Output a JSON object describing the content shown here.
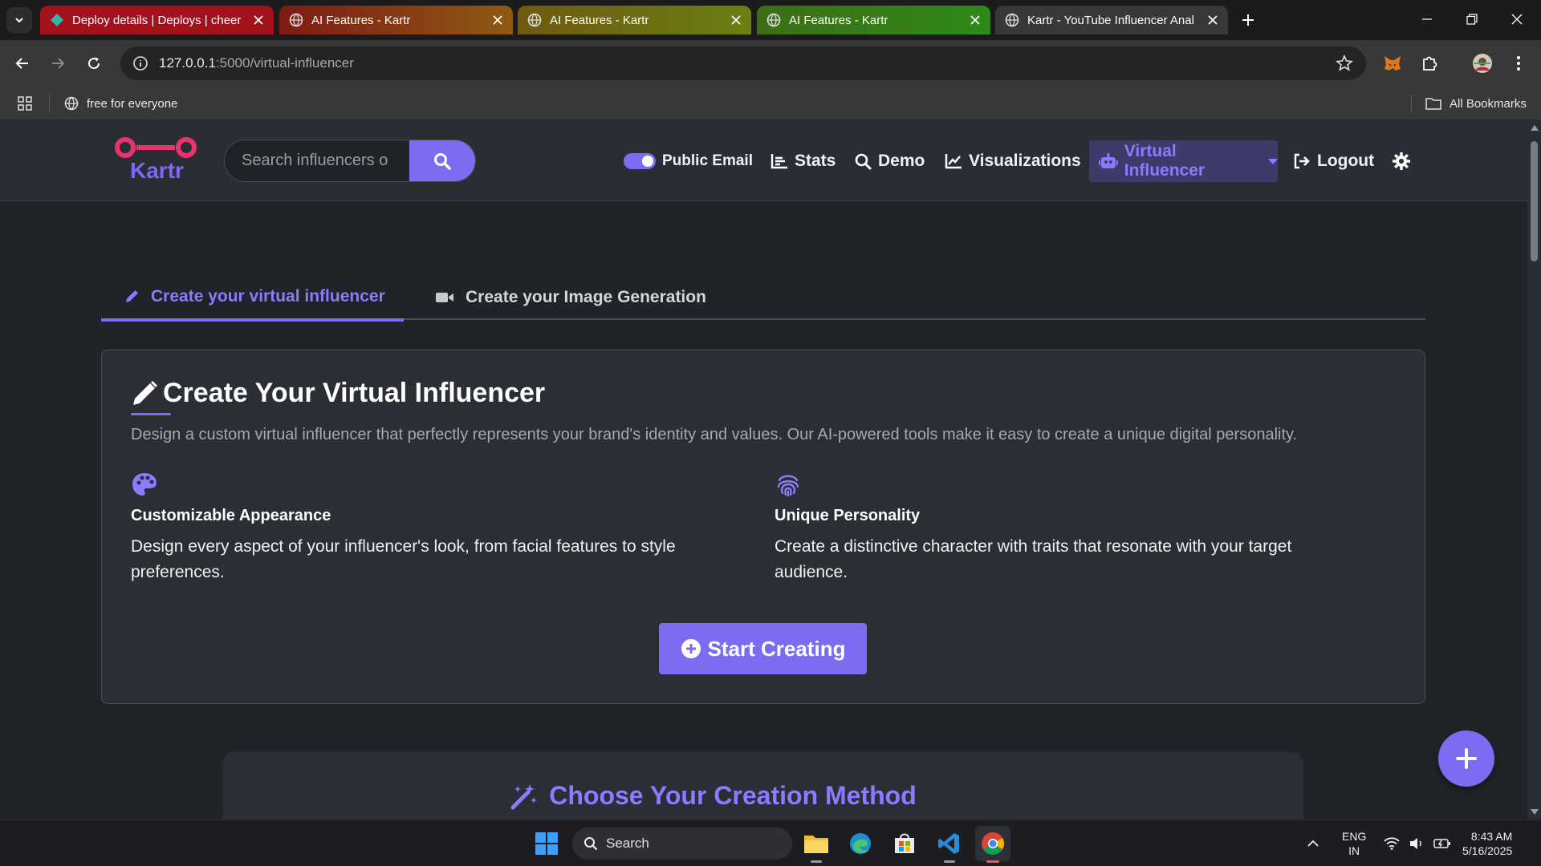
{
  "browser": {
    "tabs": [
      {
        "title": "Deploy details | Deploys | cheer"
      },
      {
        "title": "AI Features - Kartr"
      },
      {
        "title": "AI Features - Kartr"
      },
      {
        "title": "AI Features - Kartr"
      },
      {
        "title": "Kartr - YouTube Influencer Anal"
      }
    ],
    "url_host": "127.0.0.1",
    "url_rest": ":5000/virtual-influencer",
    "bookmark": "free for everyone",
    "all_bookmarks": "All Bookmarks"
  },
  "navbar": {
    "logo_text": "Kartr",
    "search_placeholder": "Search influencers o",
    "public_email": "Public Email",
    "stats": "Stats",
    "demo": "Demo",
    "visualizations": "Visualizations",
    "virtual_influencer": "Virtual Influencer",
    "logout": "Logout"
  },
  "tabs": {
    "create_influencer": "Create your virtual influencer",
    "image_generation": "Create your Image Generation"
  },
  "card": {
    "title": "Create Your Virtual Influencer",
    "description": "Design a custom virtual influencer that perfectly represents your brand's identity and values. Our AI-powered tools make it easy to create a unique digital personality.",
    "features": [
      {
        "title": "Customizable Appearance",
        "text": "Design every aspect of your influencer's look, from facial features to style preferences."
      },
      {
        "title": "Unique Personality",
        "text": "Create a distinctive character with traits that resonate with your target audience."
      }
    ],
    "start_button": "Start Creating"
  },
  "section2": {
    "title": "Choose Your Creation Method"
  },
  "taskbar": {
    "search": "Search",
    "lang": "ENG",
    "region": "IN",
    "time": "8:43 AM",
    "date": "5/16/2025"
  },
  "colors": {
    "accent": "#7c6cf2",
    "logo_pink": "#e8336e",
    "page_bg": "#202328",
    "card_bg": "#2b2e35"
  }
}
